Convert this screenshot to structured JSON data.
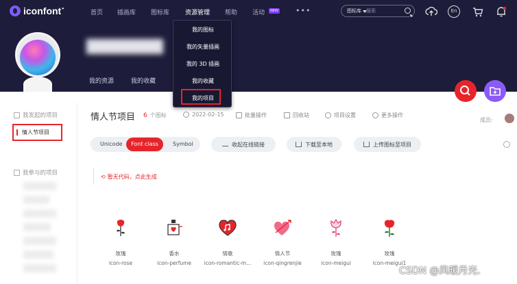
{
  "header": {
    "brand": "iconfont",
    "nav": [
      {
        "label": "首页"
      },
      {
        "label": "插画库"
      },
      {
        "label": "图标库"
      },
      {
        "label": "资源管理"
      },
      {
        "label": "帮助"
      },
      {
        "label": "活动"
      }
    ],
    "new_badge": "NEW",
    "more": "•••",
    "search": {
      "select": "图标库",
      "placeholder": "搜索"
    },
    "lang": "En"
  },
  "dropdown": {
    "items": [
      {
        "label": "我的图标"
      },
      {
        "label": "我的矢量插画"
      },
      {
        "label": "我的 3D 插画"
      },
      {
        "label": "我的收藏"
      },
      {
        "label": "我的项目"
      }
    ]
  },
  "profile": {
    "tabs": [
      {
        "label": "我的资源"
      },
      {
        "label": "我的收藏"
      }
    ]
  },
  "sidebar": {
    "created_heading": "我发起的项目",
    "active_project": "情人节项目",
    "joined_heading": "我参与的项目"
  },
  "project": {
    "title": "情人节项目",
    "count": "6",
    "count_unit": "个图标",
    "date": "2022-02-15",
    "actions": [
      {
        "label": "批量操作"
      },
      {
        "label": "回收站"
      },
      {
        "label": "项目设置"
      },
      {
        "label": "更多操作"
      }
    ],
    "member_label": "成员:"
  },
  "toolbar": {
    "tabs": [
      {
        "label": "Unicode"
      },
      {
        "label": "Font class"
      },
      {
        "label": "Symbol"
      }
    ],
    "collapse": "收起在线链接",
    "download": "下载至本地",
    "upload": "上传图标至项目"
  },
  "notice": "暂无代码，点此生成",
  "icons": [
    {
      "name": "玫瑰",
      "code": "icon-rose",
      "icon": "rose-icon",
      "color": "#e6252b"
    },
    {
      "name": "香水",
      "code": "icon-perfume",
      "icon": "perfume-icon",
      "color": "#e6252b"
    },
    {
      "name": "情歌",
      "code": "icon-romantic-m...",
      "icon": "romantic-music-icon",
      "color": "#e6252b"
    },
    {
      "name": "情人节",
      "code": "icon-qingrenjie",
      "icon": "valentine-icon",
      "color": "#f06a8a"
    },
    {
      "name": "玫瑰",
      "code": "icon-meigui",
      "icon": "rose-outline-icon",
      "color": "#e6487a"
    },
    {
      "name": "玫瑰",
      "code": "icon-meigui1",
      "icon": "rose-red-icon",
      "color": "#e6252b"
    }
  ],
  "watermark": "CSDN @风暖月光."
}
